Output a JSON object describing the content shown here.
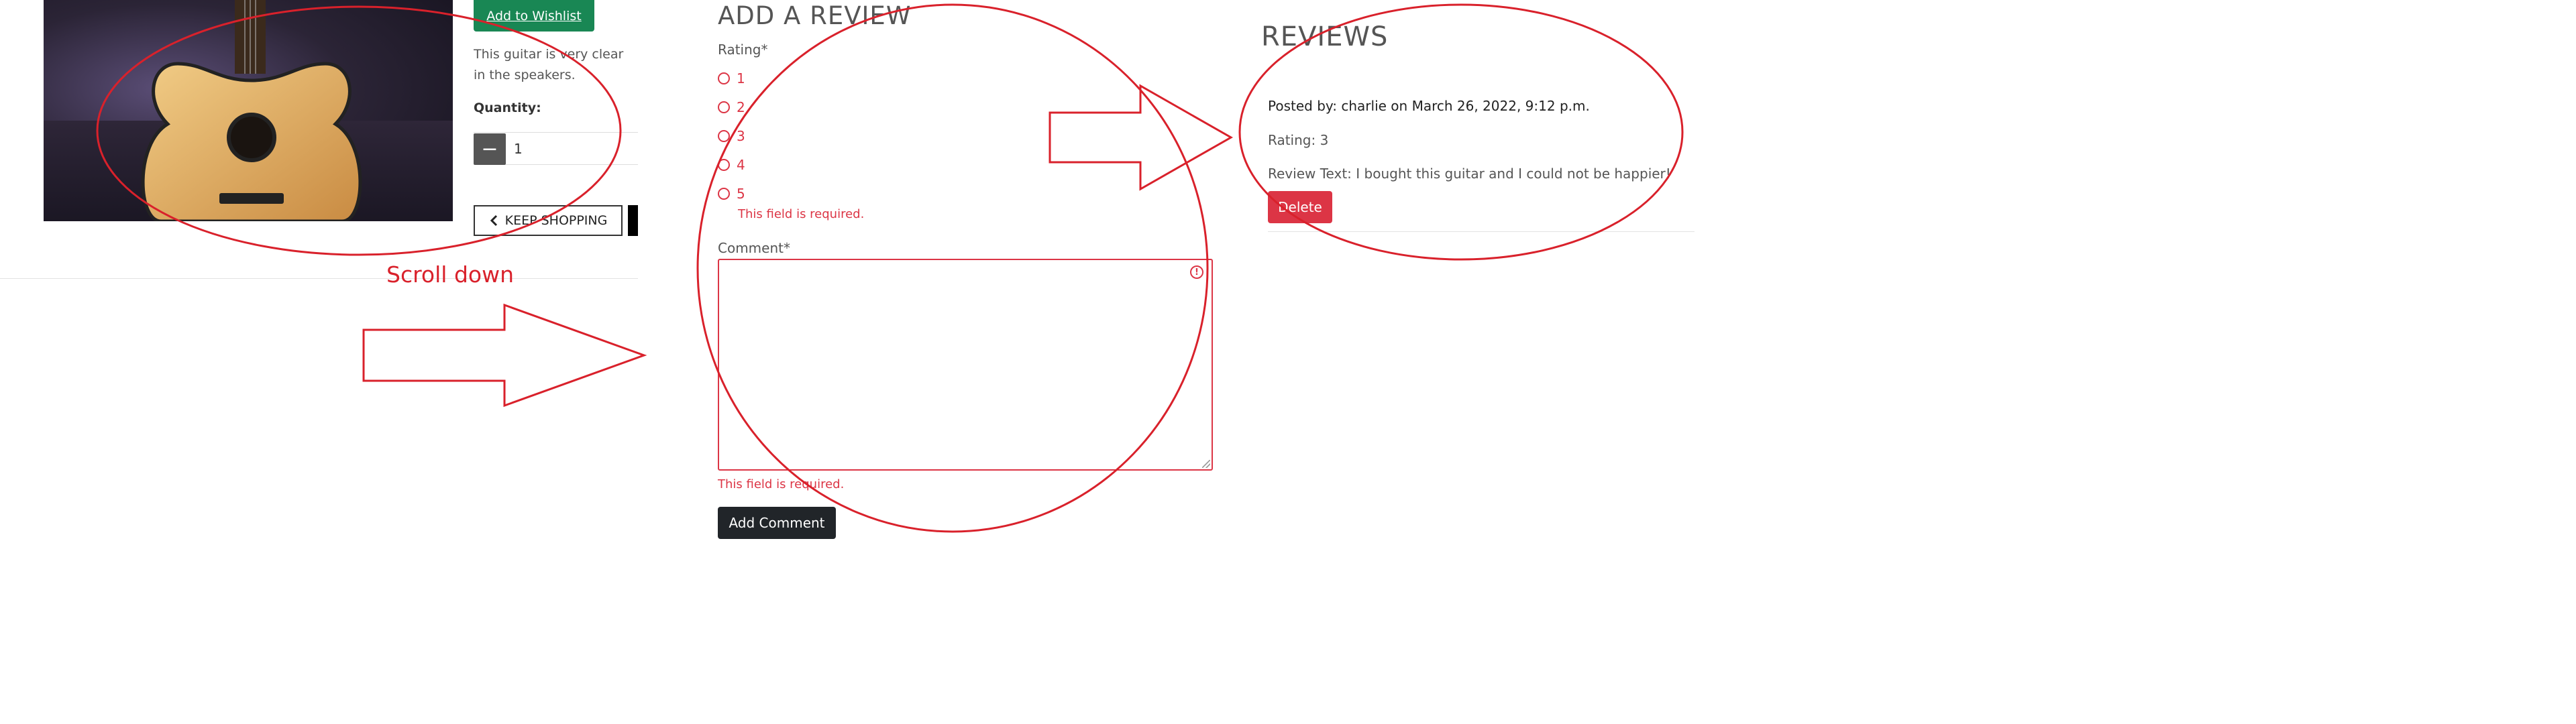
{
  "product": {
    "wishlist_label": "Add to Wishlist",
    "description": "This guitar is very clear in the speakers.",
    "quantity_label": "Quantity:",
    "quantity_value": "1",
    "minus_symbol": "−",
    "keep_shopping_label": "KEEP SHOPPING"
  },
  "annotation": {
    "scroll_caption": "Scroll down",
    "color": "#d9212b"
  },
  "add_review": {
    "heading": "ADD A REVIEW",
    "rating_label": "Rating*",
    "rating_options": [
      "1",
      "2",
      "3",
      "4",
      "5"
    ],
    "rating_error": "This field is required.",
    "comment_label": "Comment*",
    "comment_value": "",
    "comment_error": "This field is required.",
    "submit_label": "Add Comment"
  },
  "reviews": {
    "heading": "REVIEWS",
    "items": [
      {
        "meta": "Posted by: charlie on March 26, 2022, 9:12 p.m.",
        "rating": "Rating: 3",
        "text": "Review Text: I bought this guitar and I could not be happier!",
        "delete_label": "Delete"
      }
    ]
  },
  "colors": {
    "success": "#198754",
    "danger": "#dc3545",
    "dark": "#212529"
  }
}
